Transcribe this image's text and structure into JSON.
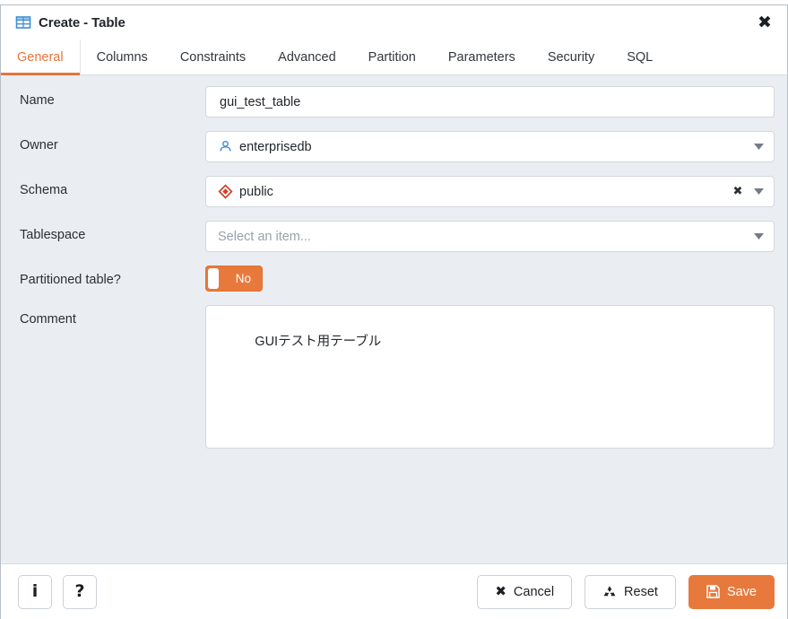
{
  "background": {
    "strip_text": "··········  ···········   ····   ·············   ···············   ················",
    "strip_accent": "·············"
  },
  "dialog": {
    "title": "Create - Table",
    "title_icon": "table-icon",
    "close_label": "✖"
  },
  "tabs": [
    {
      "label": "General",
      "active": true
    },
    {
      "label": "Columns",
      "active": false
    },
    {
      "label": "Constraints",
      "active": false
    },
    {
      "label": "Advanced",
      "active": false
    },
    {
      "label": "Partition",
      "active": false
    },
    {
      "label": "Parameters",
      "active": false
    },
    {
      "label": "Security",
      "active": false
    },
    {
      "label": "SQL",
      "active": false
    }
  ],
  "form": {
    "name": {
      "label": "Name",
      "value": "gui_test_table",
      "placeholder": ""
    },
    "owner": {
      "label": "Owner",
      "value": "enterprisedb",
      "icon": "user-icon",
      "caret": "chevron-down-icon"
    },
    "schema": {
      "label": "Schema",
      "value": "public",
      "icon": "schema-diamond-icon",
      "clear_label": "✖",
      "caret": "chevron-down-icon"
    },
    "tablespace": {
      "label": "Tablespace",
      "value": "",
      "placeholder": "Select an item...",
      "caret": "chevron-down-icon"
    },
    "partitioned": {
      "label": "Partitioned table?",
      "state_label": "No",
      "checked": false
    },
    "comment": {
      "label": "Comment",
      "value": "GUIテスト用テーブル",
      "placeholder": ""
    }
  },
  "footer": {
    "info_label": "i",
    "help_label": "?",
    "cancel_label": "Cancel",
    "reset_label": "Reset",
    "save_label": "Save"
  },
  "colors": {
    "accent": "#e8793c",
    "form_bg": "#eaeef3",
    "field_border": "#d3d8de",
    "text": "#22262b",
    "placeholder": "#9aa1ab",
    "owner_icon": "#4a90d9",
    "schema_icon": "#d0402a",
    "title_icon": "#3f8fd0"
  }
}
